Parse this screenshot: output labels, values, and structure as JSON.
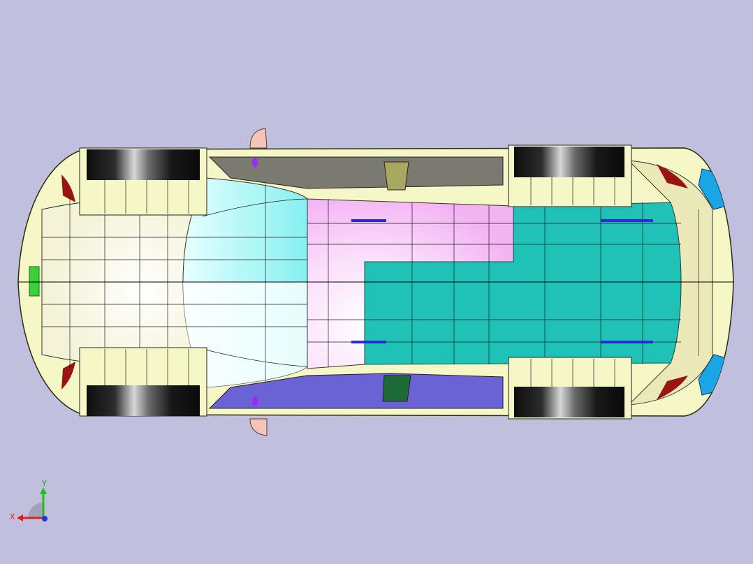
{
  "viewport": {
    "background": "#c0c0de",
    "view": "top"
  },
  "model": {
    "icon": "car-body-mesh",
    "colors": {
      "body": "#f6f7c6",
      "body_edge": "#2a2a10",
      "glass_front": "#8ff3f3",
      "roof_pink": "#f6b8f6",
      "roof_teal": "#20c2b8",
      "trim_purple": "#6b62d6",
      "trim_olive": "#a9a860",
      "pillar_green": "#1e6b3a",
      "tire": "#151515",
      "tail_light": "#1aa5e6",
      "mirror": "#f3c4b8",
      "wheel_arch_red": "#9b1414",
      "grille_green": "#3ad03a",
      "accent_blue": "#2b2bd6",
      "accent_violet": "#9a2cf0"
    }
  },
  "triad": {
    "x_label": "X",
    "y_label": "Y",
    "x_color": "#e02020",
    "y_color": "#20c020",
    "z_color": "#2030e0"
  }
}
